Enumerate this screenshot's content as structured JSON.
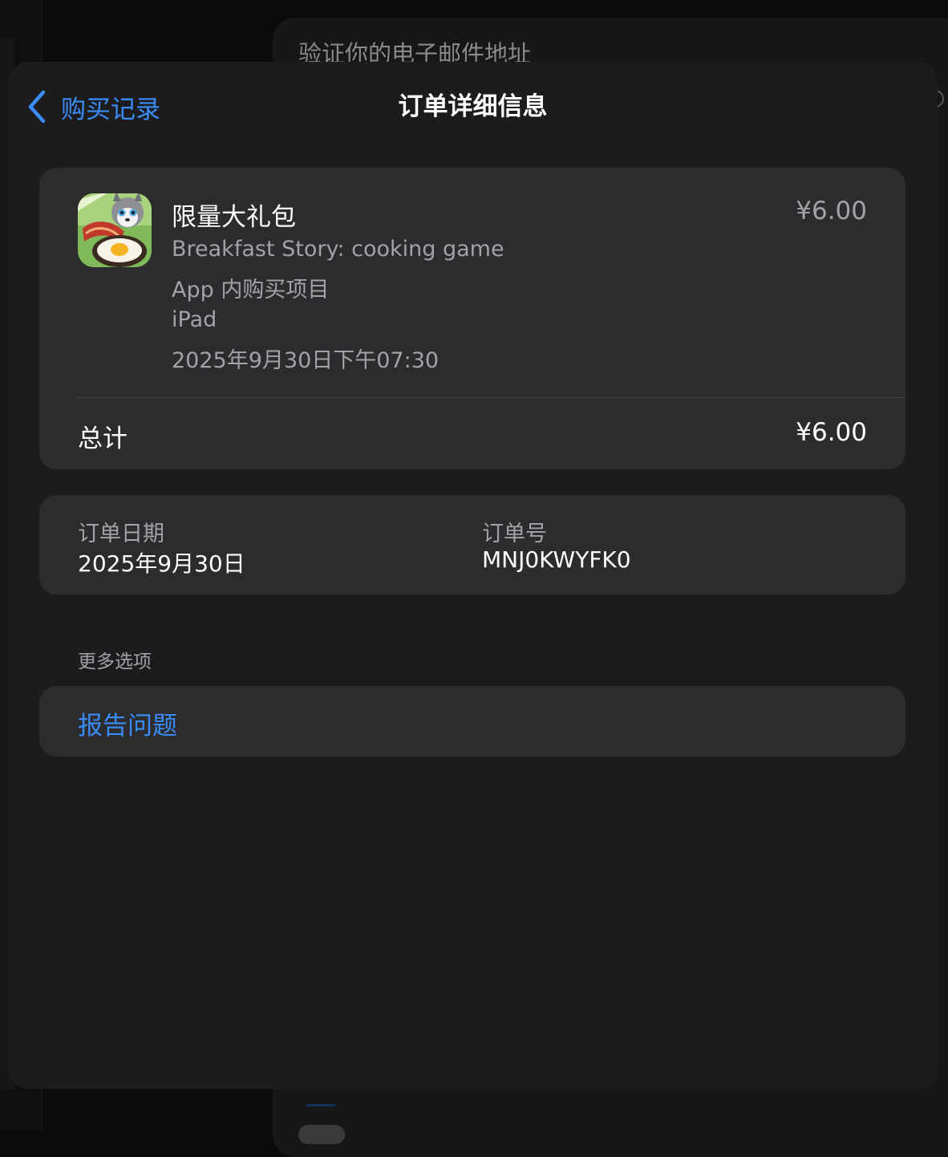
{
  "background": {
    "panel_title": "验证你的电子邮件地址"
  },
  "nav": {
    "back_label": "购买记录",
    "title": "订单详细信息"
  },
  "item": {
    "icon": "breakfast-story-app-icon",
    "title": "限量大礼包",
    "price": "¥6.00",
    "app_name": "Breakfast Story: cooking game",
    "type": "App 内购买项目",
    "device": "iPad",
    "datetime": "2025年9月30日下午07:30"
  },
  "total": {
    "label": "总计",
    "value": "¥6.00"
  },
  "order": {
    "date_label": "订单日期",
    "date_value": "2025年9月30日",
    "number_label": "订单号",
    "number_value": "MNJ0KWYFK0"
  },
  "more_options": {
    "header": "更多选项",
    "report_label": "报告问题"
  },
  "colors": {
    "accent": "#3a8cf6",
    "sheet_bg": "#1c1c1e",
    "card_bg": "#2c2c2e",
    "secondary_text": "#a2a2a7"
  }
}
